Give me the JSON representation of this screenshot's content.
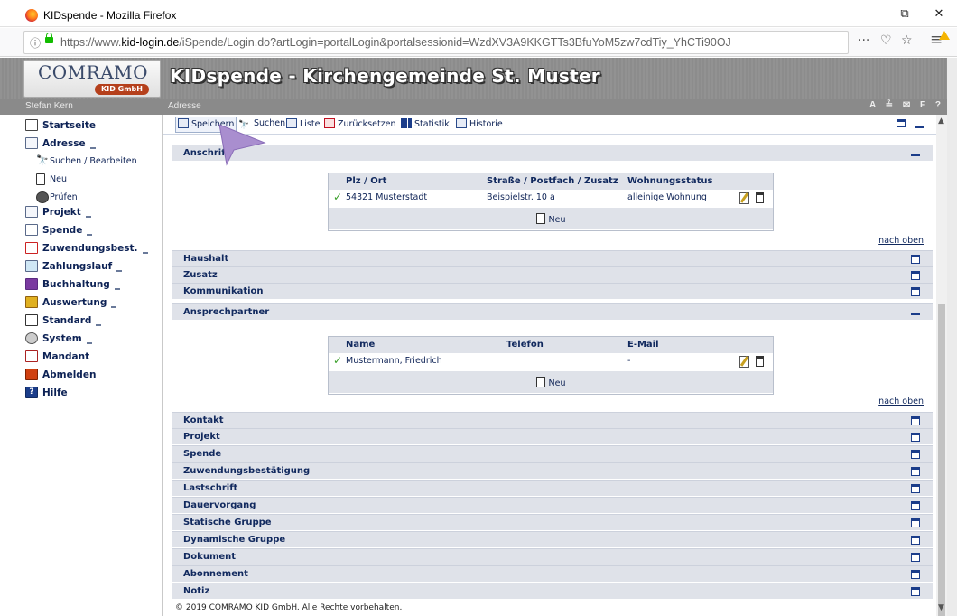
{
  "window": {
    "title": "KIDspende - Mozilla Firefox",
    "minimize": "–",
    "maximize": "⧉",
    "close": "✕"
  },
  "browser": {
    "url_prefix": "https://www.",
    "url_domain": "kid-login.de",
    "url_rest": "/iSpende/Login.do?artLogin=portalLogin&portalsessionid=WzdXV3A9KKGTTs3BfuYoM5zw7cdTiy_YhCTi90OJ",
    "more": "···",
    "pocket": "♡",
    "bookmark": "☆",
    "menu": "≡"
  },
  "banner": {
    "logo_text": "COMRAMO",
    "logo_sub": "KID GmbH",
    "app_title": "KIDspende - Kirchengemeinde St. Muster"
  },
  "strip": {
    "user": "Stefan Kern",
    "module": "Adresse",
    "right_icons": "A ≟ ✉ F ?"
  },
  "sidebar": {
    "items": [
      {
        "label": "Startseite",
        "caret": false
      },
      {
        "label": "Adresse",
        "caret": true
      },
      {
        "label": "Suchen / Bearbeiten",
        "caret": false
      },
      {
        "label": "Neu",
        "caret": false
      },
      {
        "label": "Prüfen",
        "caret": false
      },
      {
        "label": "Projekt",
        "caret": true
      },
      {
        "label": "Spende",
        "caret": true
      },
      {
        "label": "Zuwendungsbest.",
        "caret": true
      },
      {
        "label": "Zahlungslauf",
        "caret": true
      },
      {
        "label": "Buchhaltung",
        "caret": true
      },
      {
        "label": "Auswertung",
        "caret": true
      },
      {
        "label": "Standard",
        "caret": true
      },
      {
        "label": "System",
        "caret": true
      },
      {
        "label": "Mandant",
        "caret": false
      },
      {
        "label": "Abmelden",
        "caret": false
      },
      {
        "label": "Hilfe",
        "caret": false
      }
    ]
  },
  "toolbar": {
    "save": "Speichern",
    "search": "Suchen",
    "list": "Liste",
    "reset": "Zurücksetzen",
    "stats": "Statistik",
    "history": "Historie"
  },
  "sections": {
    "anschrift": "Anschrift",
    "haushalt": "Haushalt",
    "zusatz": "Zusatz",
    "kommunikation": "Kommunikation",
    "ansprechpartner": "Ansprechpartner",
    "kontakt": "Kontakt",
    "projekt": "Projekt",
    "spende": "Spende",
    "zuwendung": "Zuwendungsbestätigung",
    "lastschrift": "Lastschrift",
    "dauervorgang": "Dauervorgang",
    "statische": "Statische Gruppe",
    "dynamische": "Dynamische Gruppe",
    "dokument": "Dokument",
    "abonnement": "Abonnement",
    "notiz": "Notiz"
  },
  "address_table": {
    "headers": [
      "Plz / Ort",
      "Straße / Postfach / Zusatz",
      "Wohnungsstatus"
    ],
    "row": [
      "54321 Musterstadt",
      "Beispielstr. 10 a",
      "alleinige Wohnung"
    ],
    "new": "Neu"
  },
  "contact_table": {
    "headers": [
      "Name",
      "Telefon",
      "E-Mail"
    ],
    "row": [
      "Mustermann, Friedrich",
      "",
      "-"
    ],
    "new": "Neu"
  },
  "links": {
    "top": "nach oben"
  },
  "footer": "© 2019 COMRAMO KID GmbH. Alle Rechte vorbehalten.",
  "colors": {
    "banner": "#8c8c8c",
    "section_bg": "#dfe2e9",
    "link_dark": "#0d2255",
    "pointer": "#a98ecf"
  }
}
